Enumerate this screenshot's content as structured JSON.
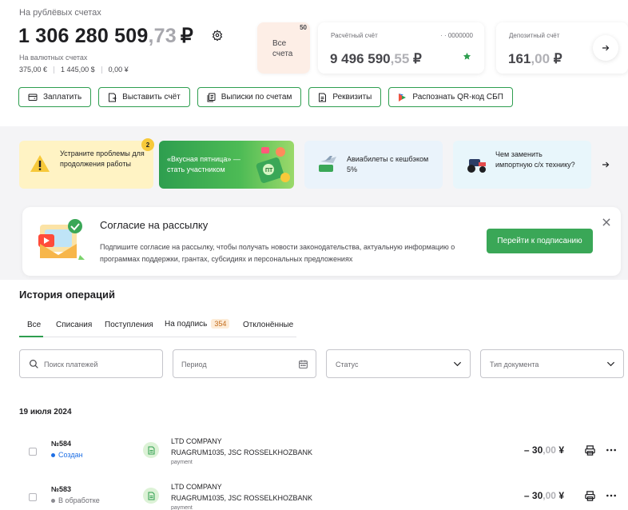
{
  "summary": {
    "rub_label": "На рублёвых счетах",
    "balance_int": "1 306 280 509",
    "balance_comma": ",",
    "balance_dec": "73",
    "balance_cur": "₽",
    "fx_label": "На валютных счетах",
    "fx_eur": "375,00 €",
    "fx_usd": "1 445,00 $",
    "fx_cny": "0,00 ¥"
  },
  "accounts": {
    "all_label_line1": "Все",
    "all_label_line2": "счета",
    "all_count": "50",
    "current": {
      "name": "Расчётный счёт",
      "number": "· · 0000000",
      "amount_int": "9 496 590",
      "amount_comma": ",",
      "amount_dec": "55",
      "cur": "₽"
    },
    "deposit": {
      "name": "Депозитный счёт",
      "amount_int": "161",
      "amount_comma": ",",
      "amount_dec": "00",
      "cur": "₽"
    }
  },
  "actions": [
    {
      "label": "Заплатить",
      "icon": "wallet-icon"
    },
    {
      "label": "Выставить счёт",
      "icon": "invoice-icon"
    },
    {
      "label": "Выписки по счетам",
      "icon": "statements-icon"
    },
    {
      "label": "Реквизиты",
      "icon": "requisites-icon"
    },
    {
      "label": "Распознать QR-код СБП",
      "icon": "sbp-icon"
    }
  ],
  "promos": [
    {
      "text": "Устраните проблемы для продолжения работы",
      "badge": "2"
    },
    {
      "text": "«Вкусная пятница» — стать участником"
    },
    {
      "text": "Авиабилеты с кешбэком 5%"
    },
    {
      "text": "Чем заменить импортную с/х технику?"
    }
  ],
  "consent": {
    "title": "Согласие на рассылку",
    "desc": "Подпишите согласие на рассылку, чтобы получать новости законодательства, актуальную информацию о программах поддержки, грантах, субсидиях и персональных предложениях",
    "button": "Перейти к подписанию"
  },
  "history": {
    "title": "История операций",
    "tabs": [
      {
        "label": "Все"
      },
      {
        "label": "Списания"
      },
      {
        "label": "Поступления"
      },
      {
        "label": "На подпись",
        "count": "354"
      },
      {
        "label": "Отклонённые"
      }
    ],
    "filters": {
      "search_placeholder": "Поиск платежей",
      "period_placeholder": "Период",
      "status_placeholder": "Статус",
      "doctype_placeholder": "Тип документа"
    },
    "date": "19 июля 2024",
    "operations": [
      {
        "number": "№584",
        "status": "Создан",
        "status_color": "#1f6fe5",
        "counterparty": "LTD COMPANY",
        "bank": "RUAGRUM1035, JSC ROSSELKHOZBANK",
        "purpose": "payment",
        "amount_int": "– 30",
        "amount_comma": ",",
        "amount_dec": "00",
        "cur": "¥"
      },
      {
        "number": "№583",
        "status": "В обработке",
        "status_color": "#8b8b91",
        "counterparty": "LTD COMPANY",
        "bank": "RUAGRUM1035, JSC ROSSELKHOZBANK",
        "purpose": "payment",
        "amount_int": "– 30",
        "amount_comma": ",",
        "amount_dec": "00",
        "cur": "¥"
      }
    ]
  },
  "colors": {
    "accent": "#2e9e4f",
    "button_green": "#3aa757",
    "warning": "#fff3c4",
    "promo_green": "#3fb549"
  }
}
